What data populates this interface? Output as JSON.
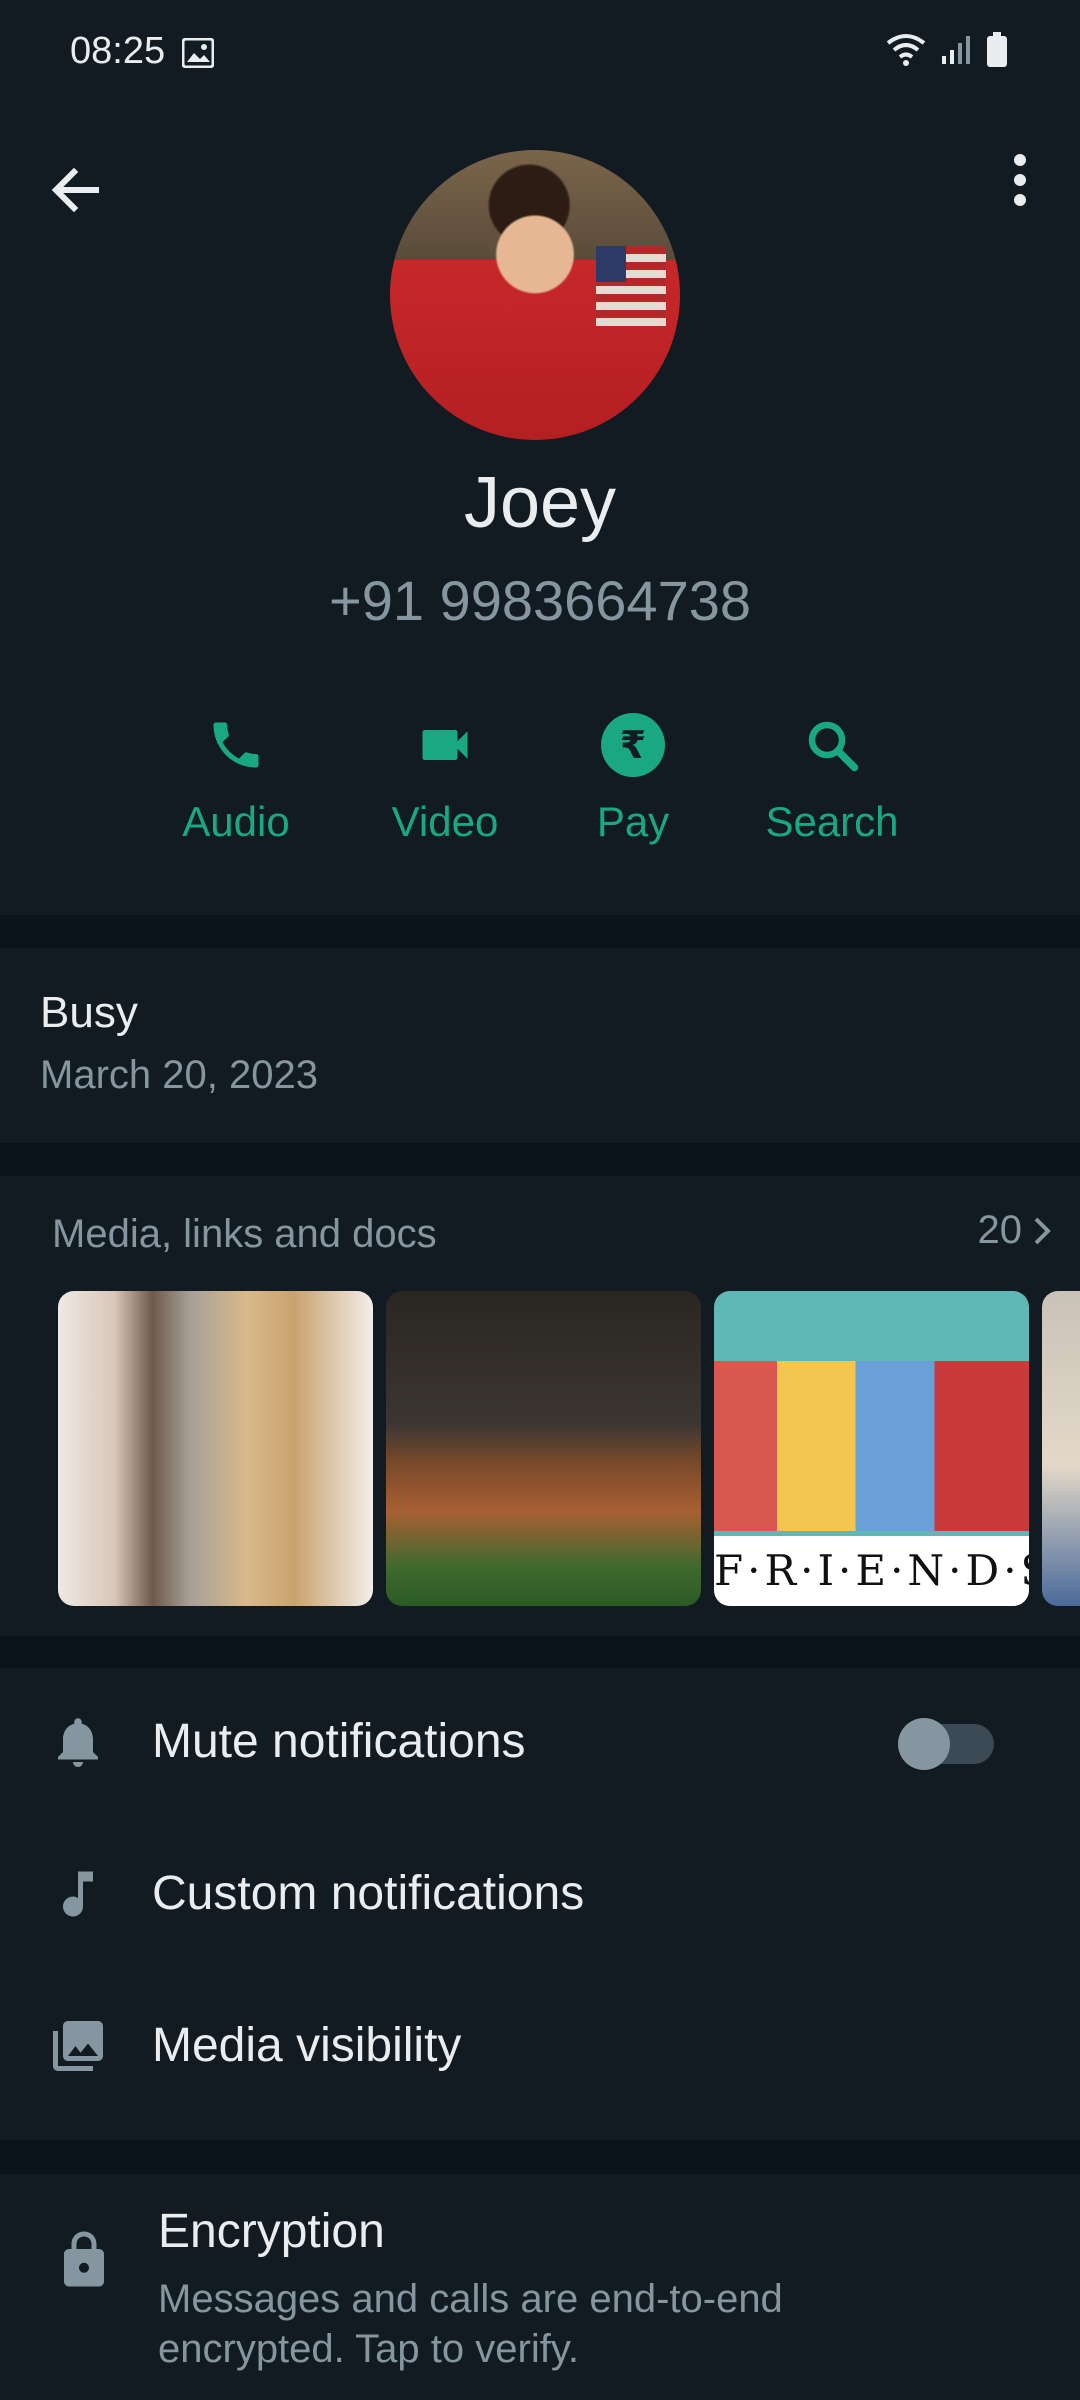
{
  "status_bar": {
    "time": "08:25"
  },
  "contact": {
    "name": "Joey",
    "phone": "+91 9983664738"
  },
  "actions": [
    {
      "label": "Audio",
      "icon": "phone-icon"
    },
    {
      "label": "Video",
      "icon": "video-icon"
    },
    {
      "label": "Pay",
      "icon": "rupee-icon"
    },
    {
      "label": "Search",
      "icon": "search-icon"
    }
  ],
  "about": {
    "status": "Busy",
    "date": "March 20, 2023"
  },
  "media": {
    "title": "Media, links and docs",
    "count": "20"
  },
  "settings": {
    "mute": "Mute notifications",
    "custom": "Custom notifications",
    "visibility": "Media visibility",
    "mute_enabled": false
  },
  "encryption": {
    "title": "Encryption",
    "subtitle": "Messages and calls are end-to-end encrypted. Tap to verify."
  },
  "colors": {
    "accent": "#1aa883",
    "background": "#111b21",
    "secondary_text": "#8696a0"
  }
}
